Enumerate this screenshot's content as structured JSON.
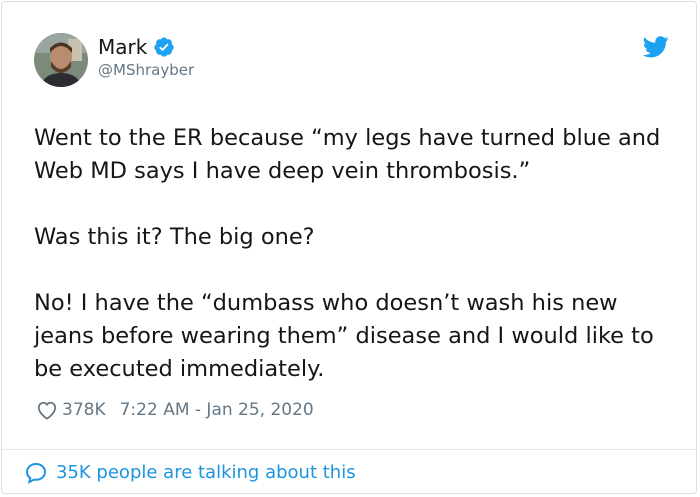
{
  "author": {
    "name": "Mark",
    "handle": "@MShrayber",
    "avatar_icon": "avatar-photo",
    "verified_icon": "verified-badge-icon"
  },
  "platform_icon": "twitter-bird-icon",
  "tweet": {
    "paragraphs": [
      "Went to the ER because “my legs have turned blue and Web MD says I have deep vein thrombosis.”",
      "Was this it? The big one?",
      "No! I have the “dumbass who doesn’t wash his new jeans before wearing them” disease and I would like to be executed immediately."
    ]
  },
  "meta": {
    "like_icon": "heart-icon",
    "likes": "378K",
    "timestamp": "7:22 AM - Jan 25, 2020"
  },
  "footer": {
    "icon": "speech-bubble-icon",
    "label": "35K people are talking about this"
  },
  "colors": {
    "brand": "#1da1f2",
    "link": "#1b95e0",
    "text": "#14171a",
    "muted": "#657786"
  }
}
